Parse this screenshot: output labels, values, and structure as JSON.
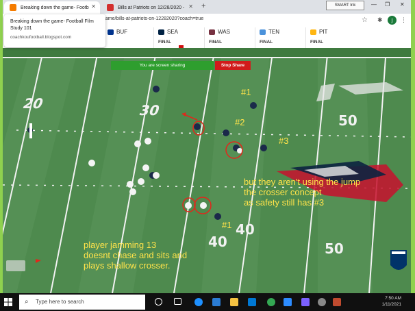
{
  "browser": {
    "tabs": [
      {
        "title": "Breaking down the game- Footb",
        "favicon_color": "#f57c00"
      },
      {
        "title": "Bills at Patriots on 12/28/2020 -",
        "favicon_color": "#d32f2f"
      }
    ],
    "new_tab": "+",
    "smart_ink": "SMART Ink",
    "url": "game/bills-at-patriots-on-12282020?coach=true",
    "avatar_letter": "j"
  },
  "tooltip": {
    "title": "Breaking down the game- Football Film Study 101",
    "domain": "coachkoufootball.blogspot.com"
  },
  "scores": [
    {
      "team": "BUF",
      "status": "",
      "color": "#00338d"
    },
    {
      "team": "SEA",
      "status": "FINAL",
      "color": "#002244"
    },
    {
      "team": "WAS",
      "status": "FINAL",
      "color": "#773141"
    },
    {
      "team": "TEN",
      "status": "FINAL",
      "color": "#4b92db"
    },
    {
      "team": "PIT",
      "status": "FINAL",
      "color": "#ffb612"
    }
  ],
  "screen_share": {
    "message": "You are screen sharing",
    "stop_label": "Stop Share"
  },
  "field": {
    "yard_numbers": [
      "20",
      "30",
      "40",
      "50",
      "40",
      "50"
    ]
  },
  "annotations": {
    "label_1_top": "#1",
    "label_2": "#2",
    "label_3": "#3",
    "label_1_bottom": "#1",
    "note_right": [
      "but they aren't using the jump",
      "the crosser concept",
      "as safety still has #3"
    ],
    "note_left": [
      "player jamming 13",
      "doesnt chase and sits and",
      "plays shallow crosser."
    ]
  },
  "taskbar": {
    "search_placeholder": "Type here to search",
    "time": "7:50 AM",
    "date": "1/11/2021"
  },
  "colors": {
    "field_green": "#4e8a4e",
    "annotation_yellow": "#ffe34a",
    "circle_red": "#e3261b"
  }
}
